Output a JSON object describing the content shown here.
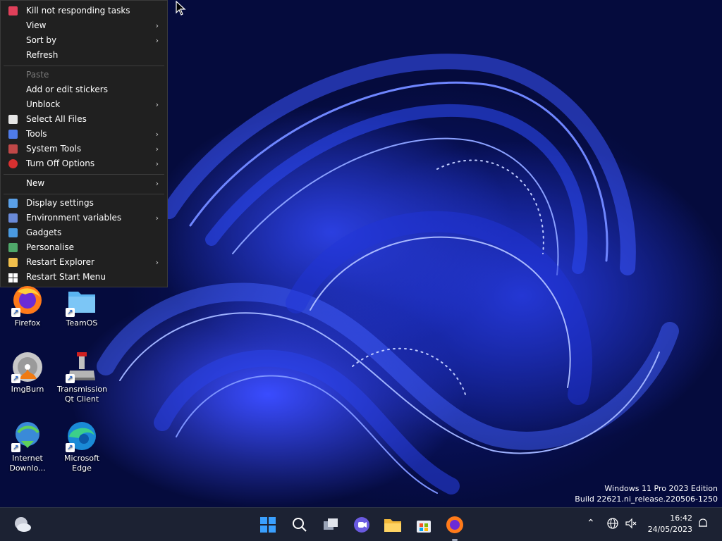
{
  "context_menu": {
    "items": [
      {
        "label": "Kill not responding tasks",
        "icon": "shield-x-icon",
        "icon_color": "#e0405a",
        "submenu": false
      },
      {
        "label": "View",
        "submenu": true
      },
      {
        "label": "Sort by",
        "submenu": true
      },
      {
        "label": "Refresh",
        "submenu": false
      },
      {
        "label": "Paste",
        "submenu": false,
        "disabled": true
      },
      {
        "label": "Add or edit stickers",
        "submenu": false
      },
      {
        "label": "Unblock",
        "submenu": true
      },
      {
        "label": "Select All Files",
        "icon": "files-icon",
        "icon_color": "#e6e6e6",
        "submenu": false
      },
      {
        "label": "Tools",
        "icon": "arrow-icon",
        "icon_color": "#4f7be8",
        "submenu": true
      },
      {
        "label": "System Tools",
        "icon": "tools-icon",
        "icon_color": "#c04848",
        "submenu": true
      },
      {
        "label": "Turn Off Options",
        "icon": "power-icon",
        "icon_color": "#d83030",
        "submenu": true
      },
      {
        "label": "New",
        "submenu": true
      },
      {
        "label": "Display settings",
        "icon": "monitor-icon",
        "icon_color": "#5aa0e8",
        "submenu": false
      },
      {
        "label": "Environment variables",
        "icon": "computer-icon",
        "icon_color": "#6a8ad8",
        "submenu": true
      },
      {
        "label": "Gadgets",
        "icon": "gadgets-icon",
        "icon_color": "#4a9ae0",
        "submenu": false
      },
      {
        "label": "Personalise",
        "icon": "personalise-icon",
        "icon_color": "#4fa86a",
        "submenu": false
      },
      {
        "label": "Restart Explorer",
        "icon": "folder-icon",
        "icon_color": "#f2c04c",
        "submenu": true
      },
      {
        "label": "Restart Start Menu",
        "icon": "windows-icon",
        "icon_color": "#ffffff",
        "submenu": false
      }
    ]
  },
  "desktop_icons": [
    {
      "label": "Firefox",
      "icon": "firefox-icon"
    },
    {
      "label": "TeamOS",
      "icon": "folder-icon"
    },
    {
      "label": "ImgBurn",
      "icon": "imgburn-icon"
    },
    {
      "label": "Transmission Qt Client",
      "icon": "transmission-icon"
    },
    {
      "label": "Internet Downlo...",
      "icon": "idm-icon"
    },
    {
      "label": "Microsoft Edge",
      "icon": "edge-icon"
    }
  ],
  "watermark": {
    "line1": "Windows 11 Pro 2023 Edition",
    "line2": "Build 22621.ni_release.220506-1250"
  },
  "taskbar": {
    "apps": [
      "weather-icon",
      "start-icon",
      "search-icon",
      "task-view-icon",
      "chat-icon",
      "file-explorer-icon",
      "store-icon",
      "firefox-icon"
    ],
    "time": "16:42",
    "date": "24/05/2023"
  }
}
